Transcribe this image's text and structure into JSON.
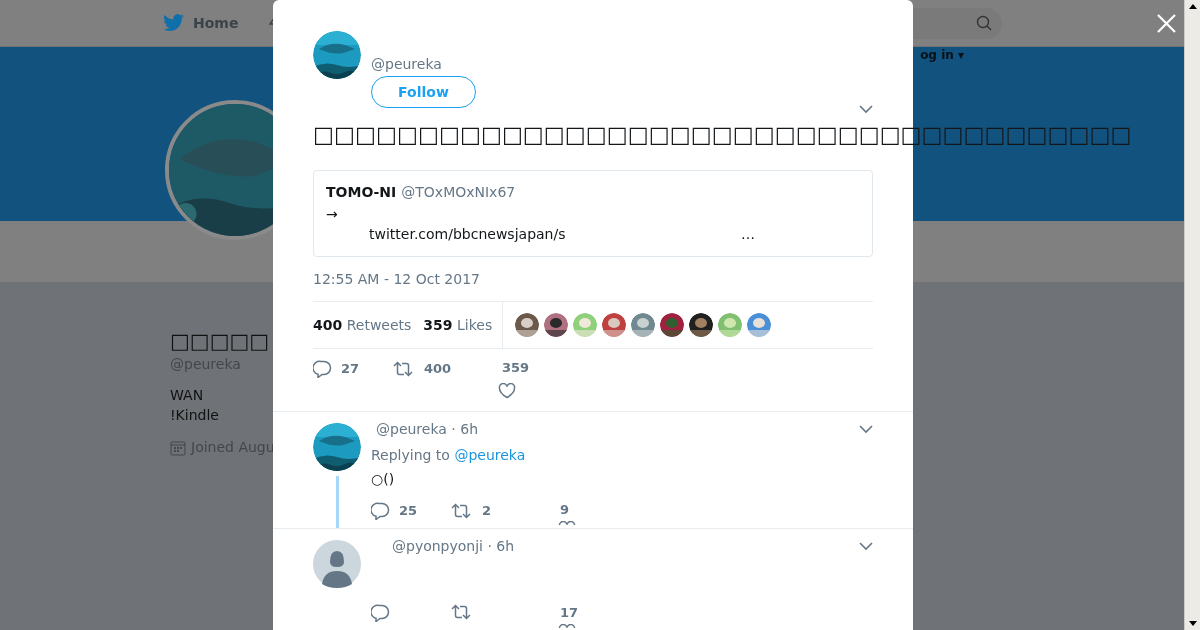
{
  "background": {
    "nav": {
      "home": "Home",
      "login": "og in ▾"
    },
    "profile": {
      "name": "□□□□□",
      "handle": "@peureka",
      "bio": [
        "WAN",
        "!Kindle"
      ],
      "joined": "Joined Augu"
    }
  },
  "tweet": {
    "handle": "@peureka",
    "follow": "Follow",
    "text": "□□□□□□□□□□□□□□□□□□□□□□□□□□□□□□□□□□□□□□□",
    "quote": {
      "name": "TOMO-NI",
      "handle": "@TOxMOxNIx67",
      "arrow": "→",
      "link": "twitter.com/bbcnewsjapan/s",
      "ellipsis": "…"
    },
    "time": "12:55 AM - 12 Oct 2017",
    "retweets": {
      "count": "400",
      "label": "Retweets"
    },
    "likes": {
      "count": "359",
      "label": "Likes"
    },
    "actions": {
      "replies": "27",
      "retweets": "400",
      "likes": "359"
    }
  },
  "replies": [
    {
      "meta": "@peureka · 6h",
      "replying_label": "Replying to",
      "replying_to": "@peureka",
      "text": "○()",
      "thread": true,
      "actions": {
        "replies": "25",
        "retweets": "2",
        "likes": "9"
      }
    },
    {
      "avatar": {
        "kind": "default"
      },
      "meta": "@pyonpyonji · 6h",
      "thread": false,
      "actions": {
        "likes": "17"
      }
    }
  ]
}
